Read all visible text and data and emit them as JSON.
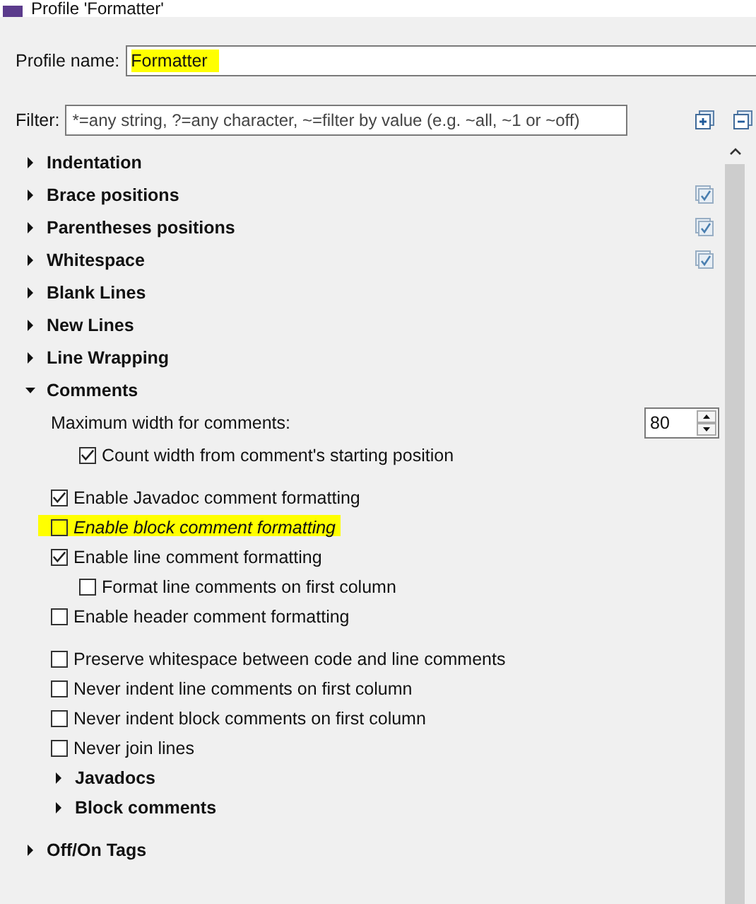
{
  "window": {
    "title": "Profile 'Formatter'"
  },
  "profile_name": {
    "label": "Profile name:",
    "value": "Formatter",
    "highlighted": true
  },
  "filter": {
    "label": "Filter:",
    "placeholder": "*=any string, ?=any character, ~=filter by value (e.g. ~all, ~1 or ~off)"
  },
  "sections": [
    {
      "label": "Indentation",
      "expanded": false,
      "checked": false
    },
    {
      "label": "Brace positions",
      "expanded": false,
      "checked": true
    },
    {
      "label": "Parentheses positions",
      "expanded": false,
      "checked": true
    },
    {
      "label": "Whitespace",
      "expanded": false,
      "checked": true
    },
    {
      "label": "Blank Lines",
      "expanded": false,
      "checked": false
    },
    {
      "label": "New Lines",
      "expanded": false,
      "checked": false
    },
    {
      "label": "Line Wrapping",
      "expanded": false,
      "checked": false
    },
    {
      "label": "Comments",
      "expanded": true,
      "checked": false,
      "groups": [
        [
          {
            "kind": "number",
            "label": "Maximum width for comments:",
            "value": "80",
            "children": [
              {
                "label": "Count width from comment's starting position",
                "checked": true,
                "italic": false,
                "highlighted": false
              }
            ]
          }
        ],
        [
          {
            "kind": "checkbox",
            "label": "Enable Javadoc comment formatting",
            "checked": true,
            "italic": false,
            "highlighted": false
          },
          {
            "kind": "checkbox",
            "label": "Enable block comment formatting",
            "checked": false,
            "italic": true,
            "highlighted": true
          },
          {
            "kind": "checkbox",
            "label": "Enable line comment formatting",
            "checked": true,
            "italic": false,
            "highlighted": false,
            "children": [
              {
                "label": "Format line comments on first column",
                "checked": false,
                "italic": false,
                "highlighted": false
              }
            ]
          },
          {
            "kind": "checkbox",
            "label": "Enable header comment formatting",
            "checked": false,
            "italic": false,
            "highlighted": false
          }
        ],
        [
          {
            "kind": "checkbox",
            "label": "Preserve whitespace between code and line comments",
            "checked": false,
            "italic": false,
            "highlighted": false
          },
          {
            "kind": "checkbox",
            "label": "Never indent line comments on first column",
            "checked": false,
            "italic": false,
            "highlighted": false
          },
          {
            "kind": "checkbox",
            "label": "Never indent block comments on first column",
            "checked": false,
            "italic": false,
            "highlighted": false
          },
          {
            "kind": "checkbox",
            "label": "Never join lines",
            "checked": false,
            "italic": false,
            "highlighted": false
          },
          {
            "kind": "section",
            "label": "Javadocs",
            "expanded": false
          },
          {
            "kind": "section",
            "label": "Block comments",
            "expanded": false
          }
        ]
      ]
    },
    {
      "label": "Off/On Tags",
      "expanded": false,
      "checked": false
    }
  ]
}
